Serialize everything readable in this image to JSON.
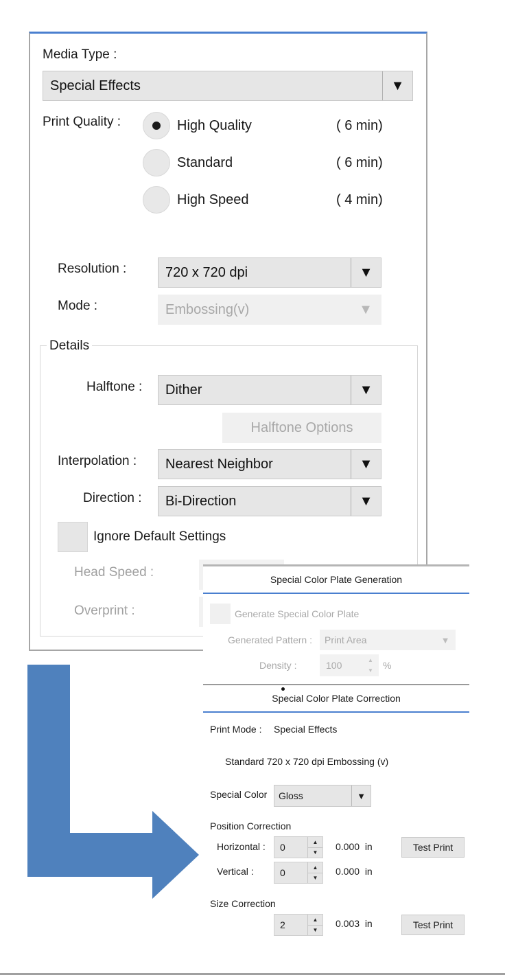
{
  "print_settings": {
    "media_type_label": "Media Type :",
    "media_type_value": "Special Effects",
    "print_quality_label": "Print Quality :",
    "quality_options": [
      {
        "label": "High Quality",
        "time": "( 6 min)",
        "selected": true
      },
      {
        "label": "Standard",
        "time": "( 6 min)",
        "selected": false
      },
      {
        "label": "High Speed",
        "time": "( 4 min)",
        "selected": false
      }
    ],
    "resolution_label": "Resolution :",
    "resolution_value": "720 x 720 dpi",
    "mode_label": "Mode :",
    "mode_value": "Embossing(v)",
    "details_legend": "Details",
    "halftone_label": "Halftone :",
    "halftone_value": "Dither",
    "halftone_options_button": "Halftone Options",
    "interpolation_label": "Interpolation :",
    "interpolation_value": "Nearest Neighbor",
    "direction_label": "Direction :",
    "direction_value": "Bi-Direction",
    "ignore_default_label": "Ignore Default Settings",
    "head_speed_label": "Head Speed :",
    "overprint_label": "Overprint :",
    "dropdown_arrow": "▼"
  },
  "special_color": {
    "generation_header": "Special Color Plate Generation",
    "generate_checkbox_label": "Generate Special Color Plate",
    "generated_pattern_label": "Generated Pattern :",
    "generated_pattern_value": "Print Area",
    "density_label": "Density :",
    "density_value": "100",
    "density_unit": "%",
    "correction_header": "Special Color Plate Correction",
    "print_mode_label": "Print Mode :",
    "print_mode_value": "Special Effects",
    "print_mode_detail": "Standard 720 x 720 dpi Embossing (v)",
    "special_color_label": "Special Color",
    "special_color_value": "Gloss",
    "position_correction_label": "Position Correction",
    "horizontal_label": "Horizontal :",
    "horizontal_value": "0",
    "horizontal_inches": "0.000  in",
    "vertical_label": "Vertical :",
    "vertical_value": "0",
    "vertical_inches": "0.000  in",
    "size_correction_label": "Size Correction",
    "size_value": "2",
    "size_inches": "0.003  in",
    "test_print_label": "Test Print",
    "spin_up": "▲",
    "spin_down": "▼"
  },
  "colors": {
    "accent_blue": "#4a7fcf",
    "arrow_blue": "#4f81bd"
  }
}
